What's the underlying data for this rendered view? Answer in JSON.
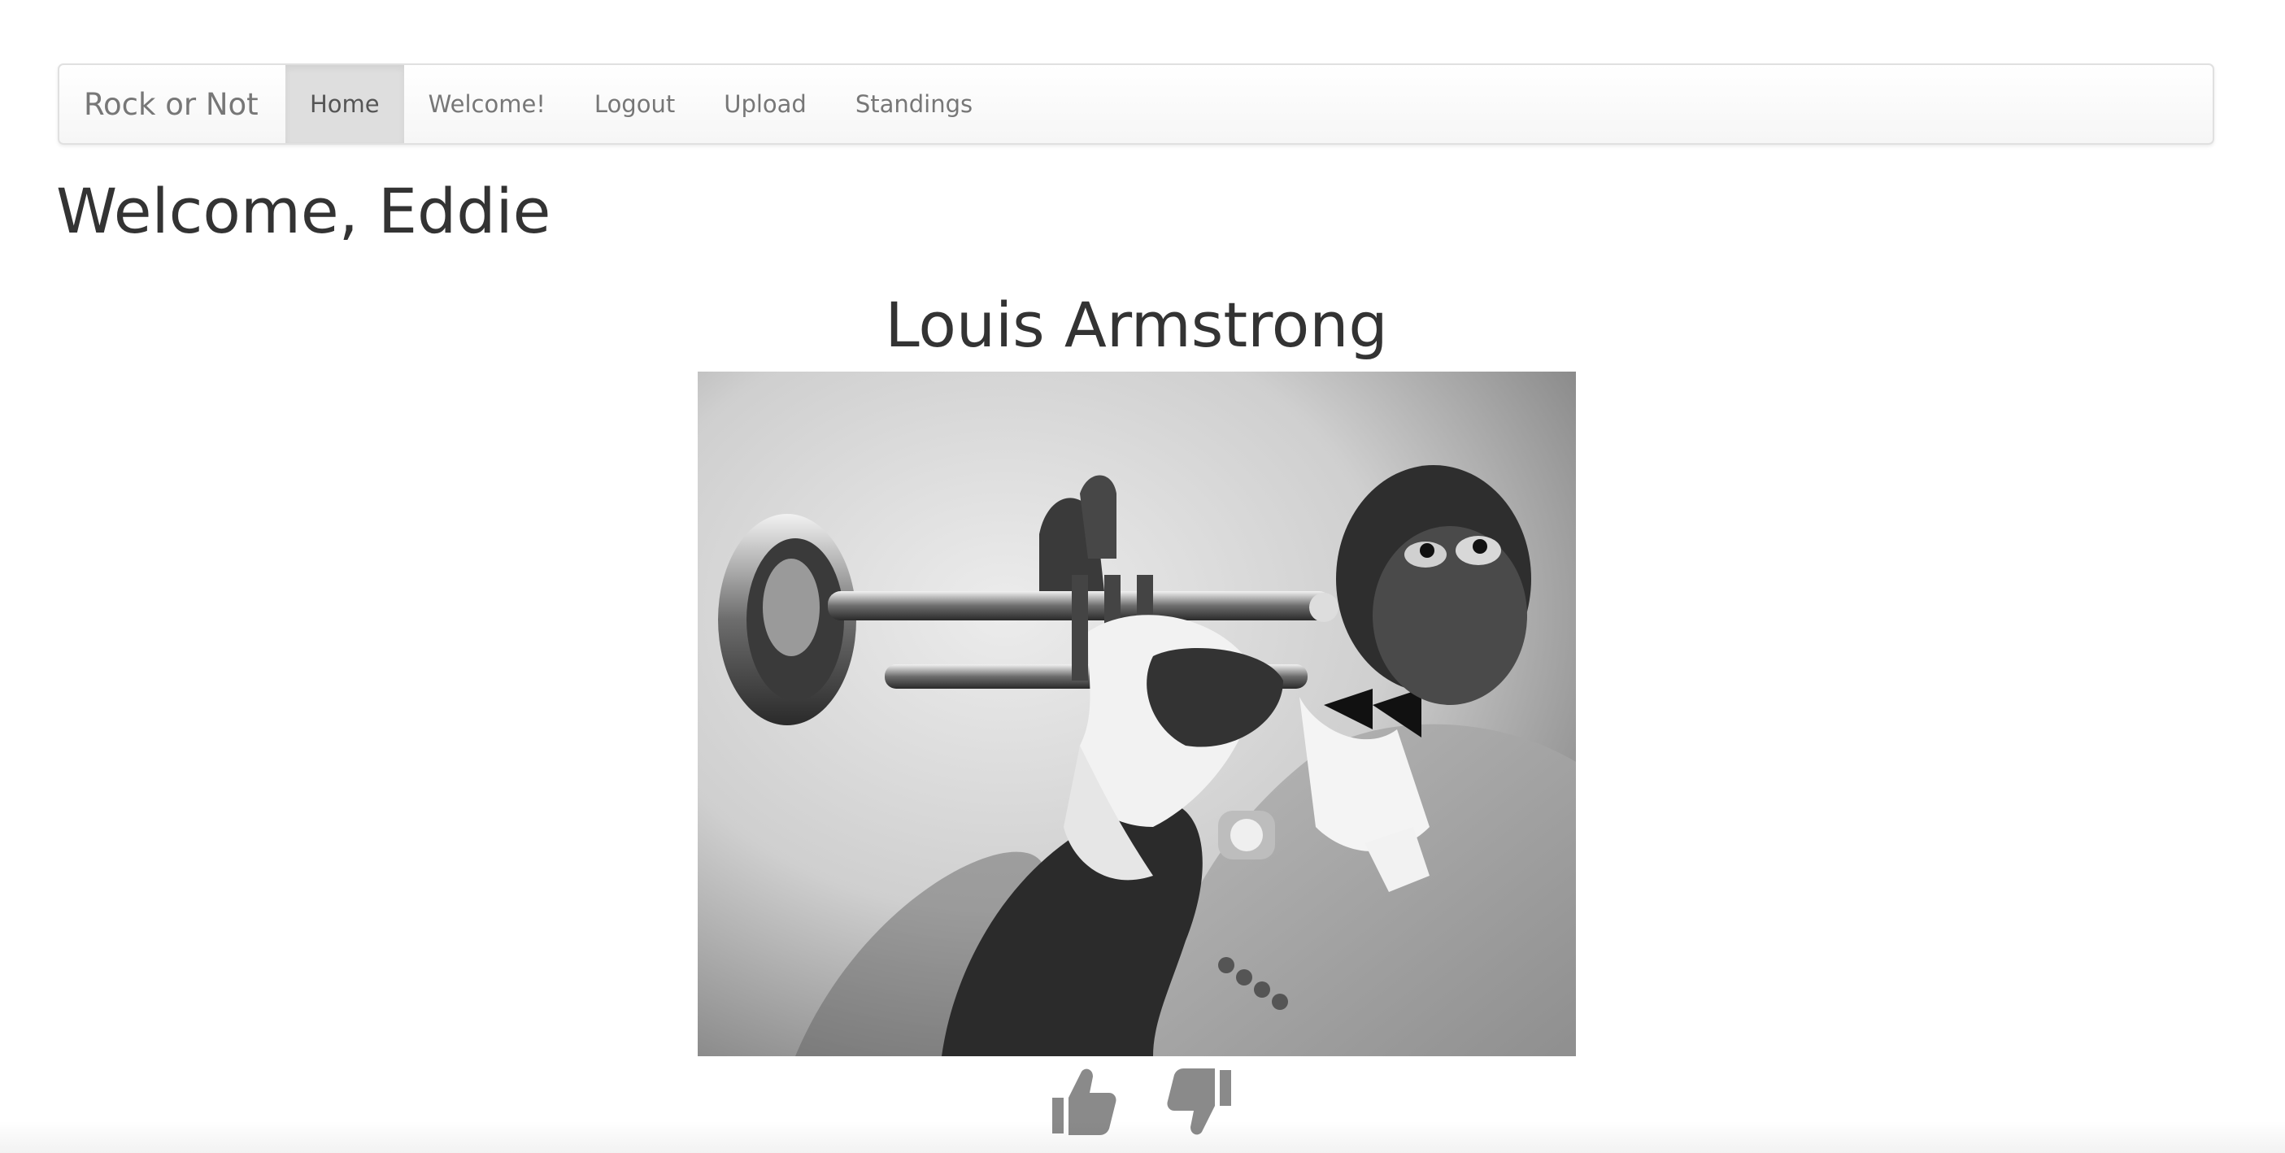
{
  "navbar": {
    "brand": "Rock or Not",
    "items": [
      {
        "label": "Home",
        "active": true
      },
      {
        "label": "Welcome!",
        "active": false
      },
      {
        "label": "Logout",
        "active": false
      },
      {
        "label": "Upload",
        "active": false
      },
      {
        "label": "Standings",
        "active": false
      }
    ]
  },
  "page": {
    "welcome": "Welcome, Eddie"
  },
  "artist": {
    "name": "Louis Armstrong",
    "photo_alt": "Louis Armstrong playing trumpet"
  },
  "vote": {
    "up_icon": "thumbs-up-icon",
    "down_icon": "thumbs-down-icon",
    "icon_color": "#8a8a8a"
  },
  "colors": {
    "navbar_bg": "#f8f8f8",
    "active_tab_bg": "#dedede",
    "nav_text": "#777777",
    "heading_text": "#333333"
  }
}
